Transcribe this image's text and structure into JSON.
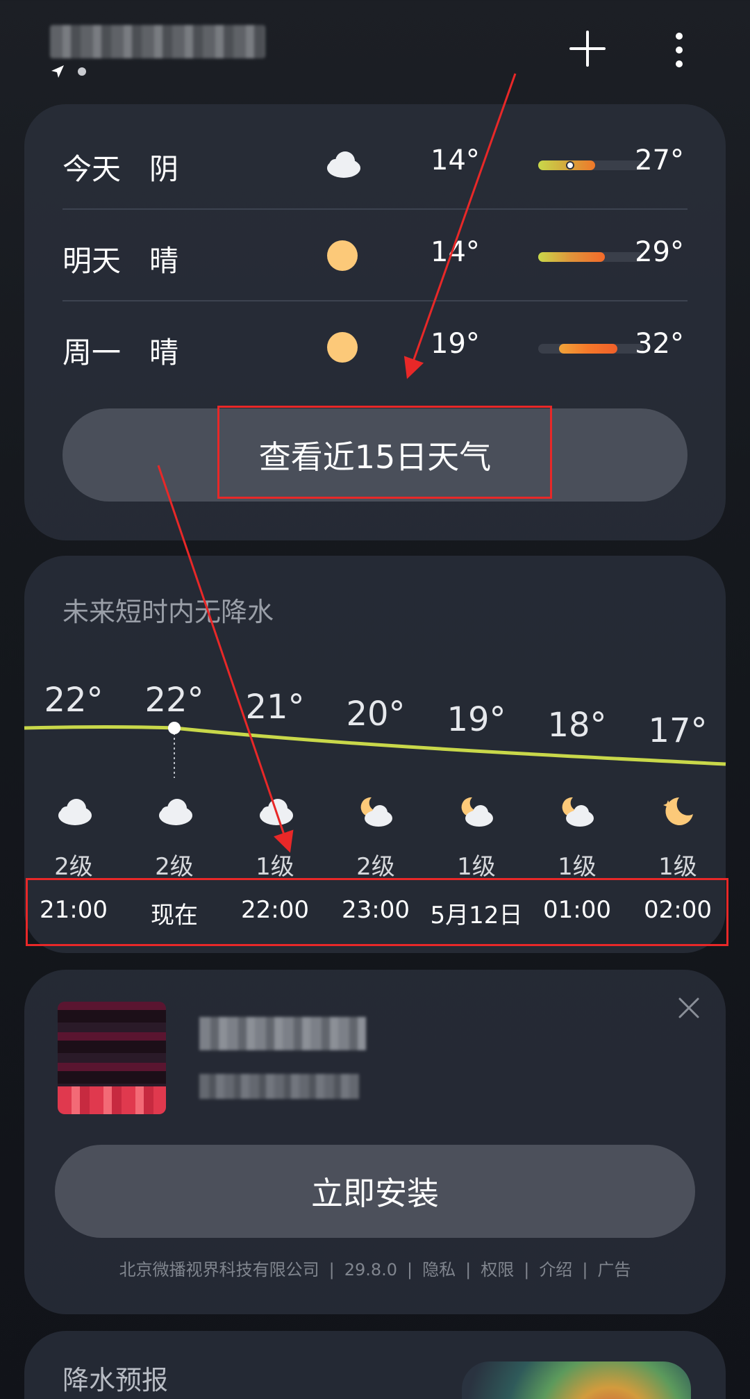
{
  "forecast": {
    "days": [
      {
        "day": "今天",
        "cond": "阴",
        "icon": "cloud-icon",
        "low": "14°",
        "high": "27°"
      },
      {
        "day": "明天",
        "cond": "晴",
        "icon": "sun-icon",
        "low": "14°",
        "high": "29°"
      },
      {
        "day": "周一",
        "cond": "晴",
        "icon": "sun-icon",
        "low": "19°",
        "high": "32°"
      }
    ],
    "button_label": "查看近15日天气"
  },
  "hourly": {
    "no_rain_text": "未来短时内无降水",
    "items": [
      {
        "temp": "22°",
        "icon": "cloud-icon",
        "wind": "2级",
        "time": "21:00"
      },
      {
        "temp": "22°",
        "icon": "cloud-icon",
        "wind": "2级",
        "time": "现在"
      },
      {
        "temp": "21°",
        "icon": "cloud-icon",
        "wind": "1级",
        "time": "22:00"
      },
      {
        "temp": "20°",
        "icon": "cloudy-night-icon",
        "wind": "2级",
        "time": "23:00"
      },
      {
        "temp": "19°",
        "icon": "cloudy-night-icon",
        "wind": "1级",
        "time": "5月12日"
      },
      {
        "temp": "18°",
        "icon": "cloudy-night-icon",
        "wind": "1级",
        "time": "01:00"
      },
      {
        "temp": "17°",
        "icon": "moon-icon",
        "wind": "1级",
        "time": "02:00"
      }
    ]
  },
  "ad": {
    "install_label": "立即安装",
    "footer": {
      "company": "北京微播视界科技有限公司",
      "version": "29.8.0",
      "privacy": "隐私",
      "permissions": "权限",
      "intro": "介绍",
      "ad": "广告"
    }
  },
  "rain": {
    "title": "降水预报"
  },
  "colors": {
    "highlight": "#e82828",
    "temp_line": "#c9d84a"
  }
}
